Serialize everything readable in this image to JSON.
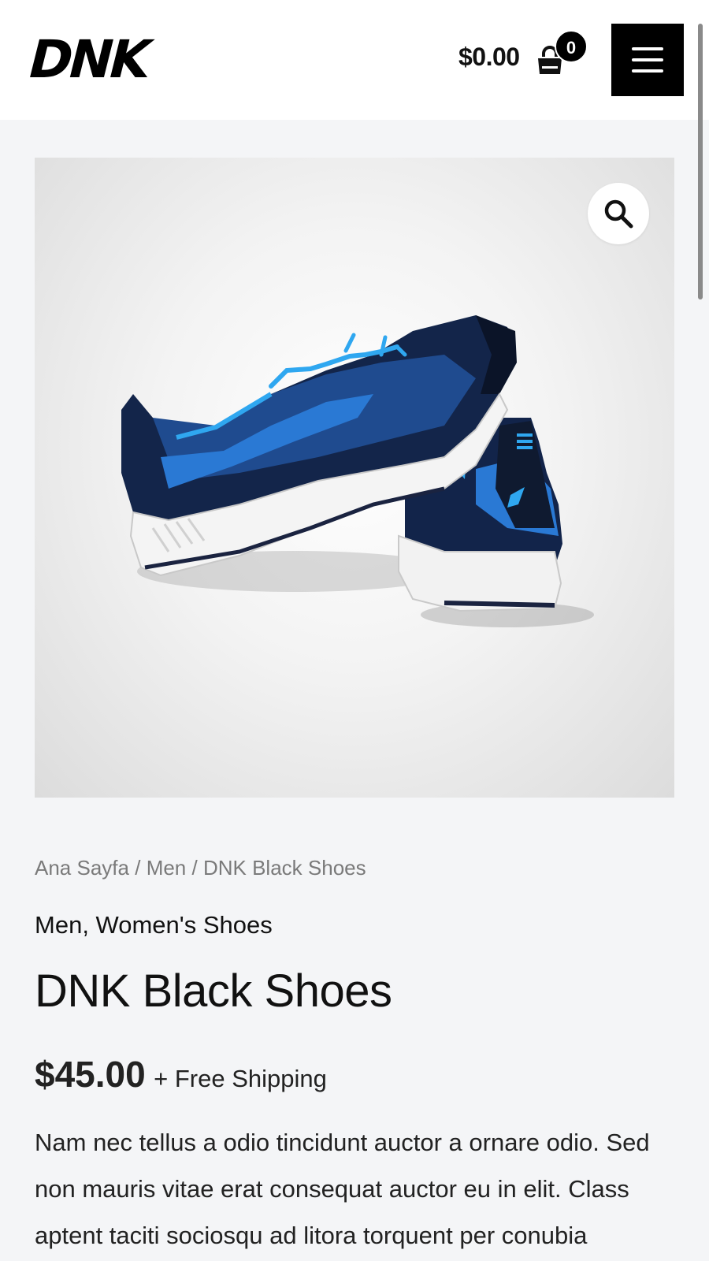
{
  "header": {
    "logo_text": "DNK",
    "cart_total": "$0.00",
    "cart_count": "0",
    "cart_icon": "shopping-bag-icon",
    "menu_icon": "hamburger-menu-icon"
  },
  "product": {
    "image_alt": "Pair of dark blue running shoes with bright blue laces and white soles",
    "zoom_icon": "magnifier-icon",
    "breadcrumb": [
      "Ana Sayfa",
      "Men",
      "DNK Black Shoes"
    ],
    "breadcrumb_separator": "/",
    "categories": [
      "Men",
      "Women's Shoes"
    ],
    "title": "DNK Black Shoes",
    "price": "$45.00",
    "shipping": "+ Free Shipping",
    "description": "Nam nec tellus a odio tincidunt auctor a ornare odio. Sed non mauris vitae erat consequat auctor eu in elit. Class aptent taciti sociosqu ad litora torquent per conubia"
  },
  "colors": {
    "page_bg": "#f4f5f7",
    "header_bg": "#ffffff",
    "accent_blue": "#1e9be8",
    "shoe_navy": "#13254a"
  }
}
